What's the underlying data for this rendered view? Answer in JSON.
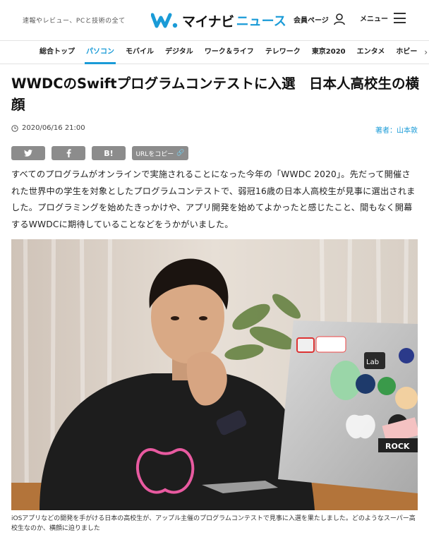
{
  "header": {
    "tagline": "速報やレビュー、PCと技術の全て",
    "logo_main": "マイナビ",
    "logo_sub": "ニュース",
    "member_label": "会員ページ",
    "menu_label": "メニュー"
  },
  "nav": {
    "items": [
      "総合トップ",
      "パソコン",
      "モバイル",
      "デジタル",
      "ワーク＆ライフ",
      "テレワーク",
      "東京2020",
      "エンタメ",
      "ホビー"
    ],
    "active_index": 1
  },
  "article": {
    "title": "WWDCのSwiftプログラムコンテストに入選　日本人高校生の横顔",
    "date": "2020/06/16 21:00",
    "author": "著者：山本敦",
    "share": {
      "twitter": "twitter-icon",
      "facebook": "facebook-icon",
      "hatena": "B!",
      "url_copy": "URLをコピー"
    },
    "lead": "すべてのプログラムがオンラインで実施されることになった今年の「WWDC 2020」。先だって開催された世界中の学生を対象としたプログラムコンテストで、弱冠16歳の日本人高校生が見事に選出されました。プログラミングを始めたきっかけや、アプリ開発を始めてよかったと感じたこと、間もなく開幕するWWDCに期待していることなどをうかがいました。",
    "photo_laptop_sticker": "ROCK",
    "photo_laptop_sticker_2": "Lab",
    "caption": "iOSアプリなどの開発を手がける日本の高校生が、アップル主催のプログラムコンテストで見事に入選を果たしました。どのようなスーパー高校生なのか、横顔に迫りました"
  },
  "colors": {
    "accent": "#1a9bd7",
    "share_button": "#8c8c8c"
  }
}
